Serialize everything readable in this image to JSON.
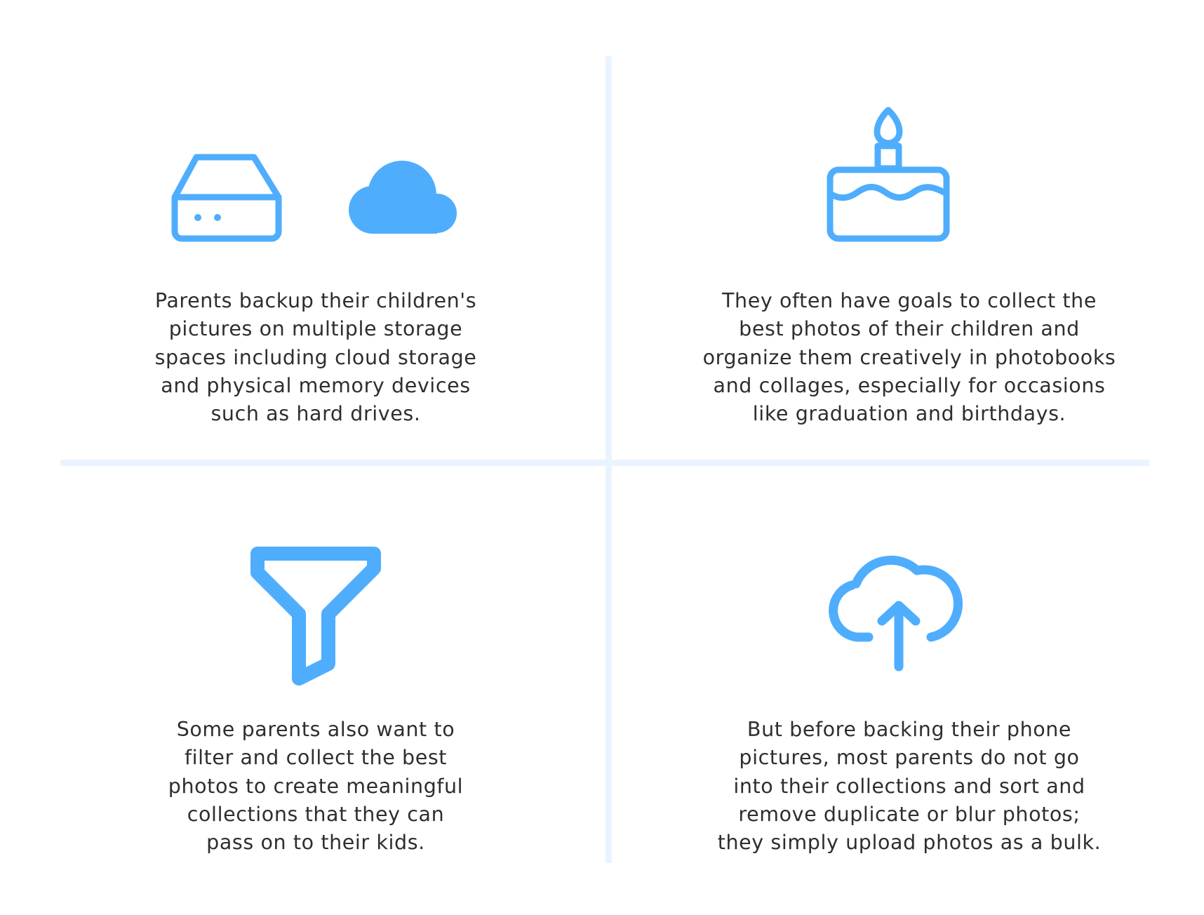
{
  "accent_color": "#4fadfd",
  "divider_color": "#eaf4ff",
  "text_color": "#2e2e2e",
  "panels": [
    {
      "icons": [
        "hard-drive-icon",
        "cloud-icon"
      ],
      "lines": [
        "Parents backup their children's",
        "pictures on multiple storage",
        "spaces including cloud storage",
        "and physical memory devices",
        "such as hard drives."
      ]
    },
    {
      "icons": [
        "birthday-cake-icon"
      ],
      "lines": [
        "They often have goals to collect the",
        "best photos of their children and",
        "organize them creatively in photobooks",
        "and collages, especially for occasions",
        "like graduation and birthdays."
      ]
    },
    {
      "icons": [
        "filter-funnel-icon"
      ],
      "lines": [
        "Some parents also want to",
        "filter and collect the best",
        "photos to create meaningful",
        "collections that they can",
        "pass on to their kids."
      ]
    },
    {
      "icons": [
        "cloud-upload-icon"
      ],
      "lines": [
        "But before backing their phone",
        "pictures, most parents do not go",
        "into their collections and sort and",
        "remove duplicate or blur photos;",
        "they simply upload photos as a bulk."
      ]
    }
  ]
}
